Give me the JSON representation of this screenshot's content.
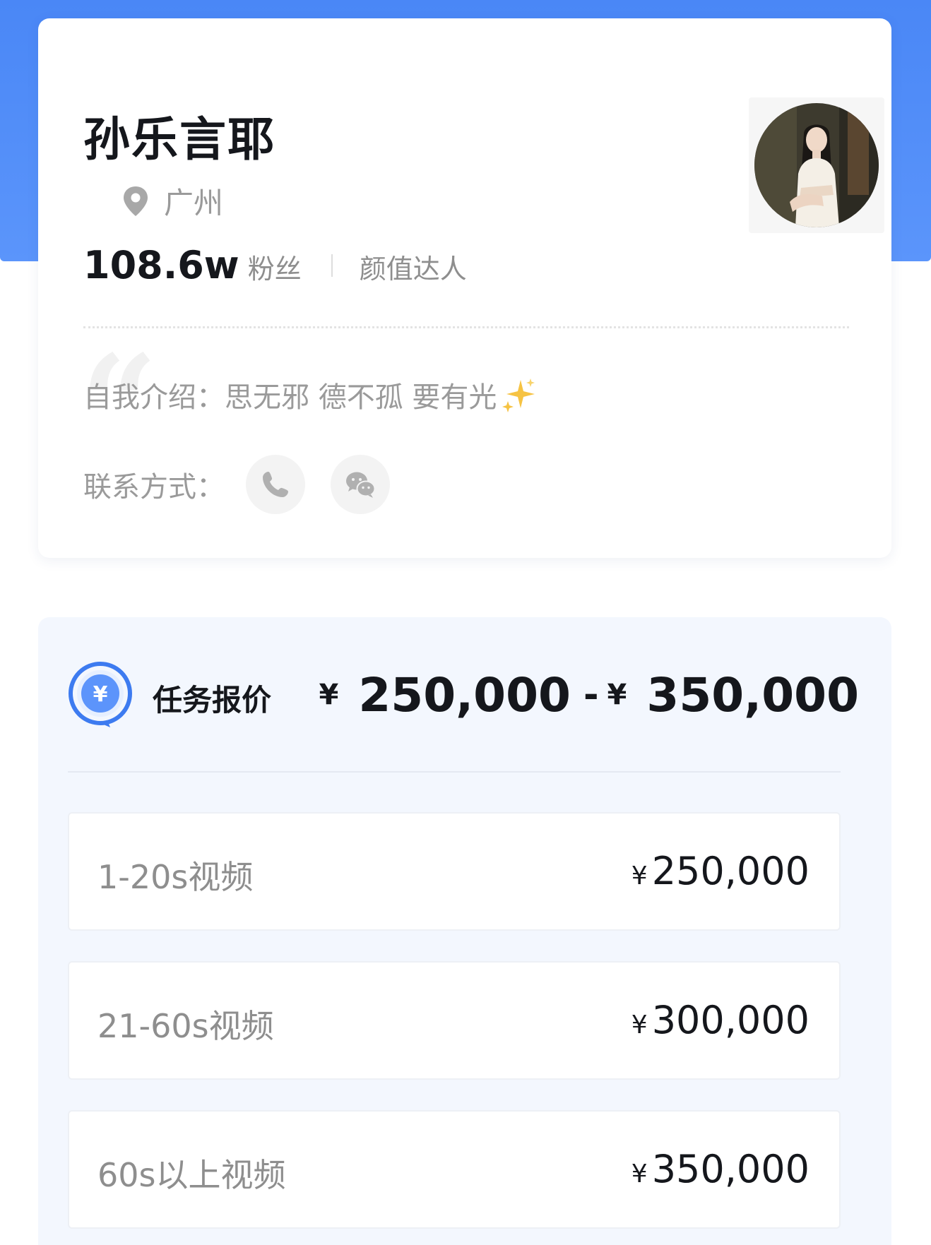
{
  "profile": {
    "name": "孙乐言耶",
    "location": "广州",
    "follower_count": "108.6w",
    "follower_label": "粉丝",
    "category": "颜值达人",
    "intro": "自我介绍：思无邪 德不孤 要有光",
    "contact_label": "联系方式：",
    "icons": [
      "location-pin-icon",
      "phone-icon",
      "wechat-icon",
      "avatar",
      "sparkle-icon"
    ]
  },
  "pricing": {
    "title": "任务报价",
    "currency": "¥",
    "range_min": "250,000",
    "range_separator": "-",
    "range_max": "350,000",
    "tiers": [
      {
        "label": "1-20s视频",
        "price": "250,000"
      },
      {
        "label": "21-60s视频",
        "price": "300,000"
      },
      {
        "label": "60s以上视频",
        "price": "350,000"
      }
    ]
  },
  "colors": {
    "accent_blue": "#4a87f6",
    "card_bg": "#ffffff",
    "pricing_bg": "#f3f7fe",
    "text_dark": "#15171c",
    "text_muted": "#9a9a9a"
  }
}
